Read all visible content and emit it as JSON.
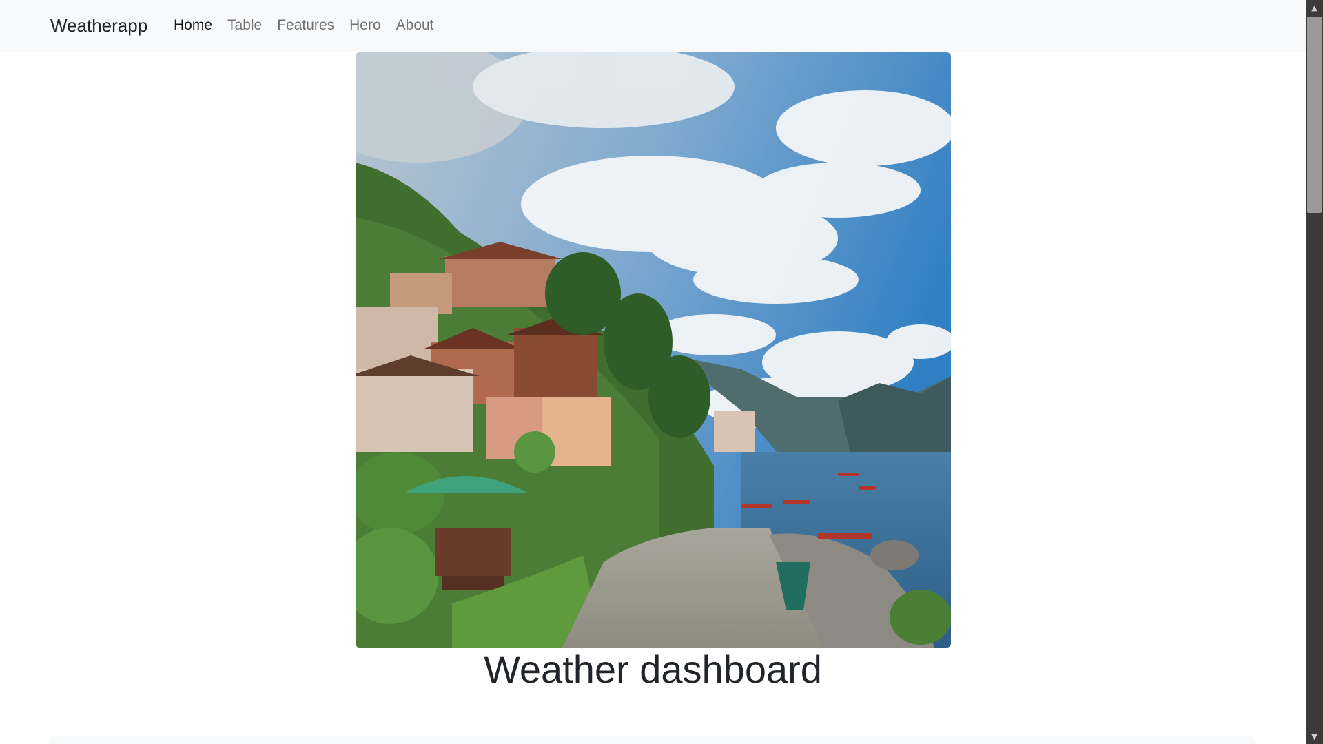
{
  "navbar": {
    "brand": "Weatherapp",
    "links": [
      {
        "label": "Home",
        "active": true
      },
      {
        "label": "Table",
        "active": false
      },
      {
        "label": "Features",
        "active": false
      },
      {
        "label": "Hero",
        "active": false
      },
      {
        "label": "About",
        "active": false
      }
    ]
  },
  "hero": {
    "image_icon": "landscape-photo-icon"
  },
  "main": {
    "title": "Weather dashboard"
  },
  "scrollbar": {
    "up_icon": "scroll-up-arrow-icon",
    "down_icon": "scroll-down-arrow-icon",
    "up_glyph": "▲",
    "down_glyph": "▼"
  },
  "colors": {
    "navbar_bg": "#f8f9fa",
    "text": "#212529",
    "sky": "#3f86c6",
    "water": "#3b6f9a"
  }
}
